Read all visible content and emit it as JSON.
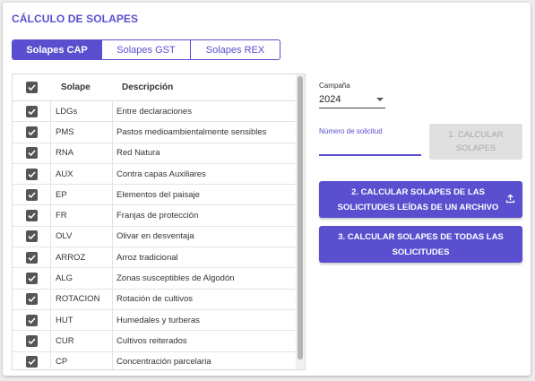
{
  "title": "CÁLCULO DE SOLAPES",
  "tabs": [
    {
      "label": "Solapes CAP",
      "active": true
    },
    {
      "label": "Solapes GST",
      "active": false
    },
    {
      "label": "Solapes REX",
      "active": false
    }
  ],
  "table": {
    "headers": {
      "code": "Solape",
      "desc": "Descripción"
    },
    "rows": [
      {
        "code": "LDGs",
        "desc": "Entre declaraciones",
        "checked": true
      },
      {
        "code": "PMS",
        "desc": "Pastos medioambientalmente sensibles",
        "checked": true
      },
      {
        "code": "RNA",
        "desc": "Red Natura",
        "checked": true
      },
      {
        "code": "AUX",
        "desc": "Contra capas Auxiliares",
        "checked": true
      },
      {
        "code": "EP",
        "desc": "Elementos del paisaje",
        "checked": true
      },
      {
        "code": "FR",
        "desc": "Franjas de protección",
        "checked": true
      },
      {
        "code": "OLV",
        "desc": "Olivar en desventaja",
        "checked": true
      },
      {
        "code": "ARROZ",
        "desc": "Arroz tradicional",
        "checked": true
      },
      {
        "code": "ALG",
        "desc": "Zonas susceptibles de Algodón",
        "checked": true
      },
      {
        "code": "ROTACION",
        "desc": "Rotación de cultivos",
        "checked": true
      },
      {
        "code": "HUT",
        "desc": "Humedales y turberas",
        "checked": true
      },
      {
        "code": "CUR",
        "desc": "Cultivos reiterados",
        "checked": true
      },
      {
        "code": "CP",
        "desc": "Concentración parcelaria",
        "checked": true
      }
    ]
  },
  "campaign": {
    "label": "Campaña",
    "value": "2024"
  },
  "solicitud": {
    "label": "Número de solicitud",
    "value": ""
  },
  "buttons": {
    "calc1": "1. CALCULAR SOLAPES",
    "calc2": "2. CALCULAR SOLAPES DE LAS SOLICITUDES LEÍDAS DE UN ARCHIVO",
    "calc3": "3. CALCULAR SOLAPES DE TODAS LAS SOLICITUDES"
  },
  "icons": {
    "checkbox": "checkbox-checked-icon",
    "upload": "upload-icon",
    "dropdown": "chevron-down-icon"
  },
  "colors": {
    "accent": "#5a4fcf",
    "checkbox": "#555555",
    "disabled": "#e0e0e0"
  }
}
